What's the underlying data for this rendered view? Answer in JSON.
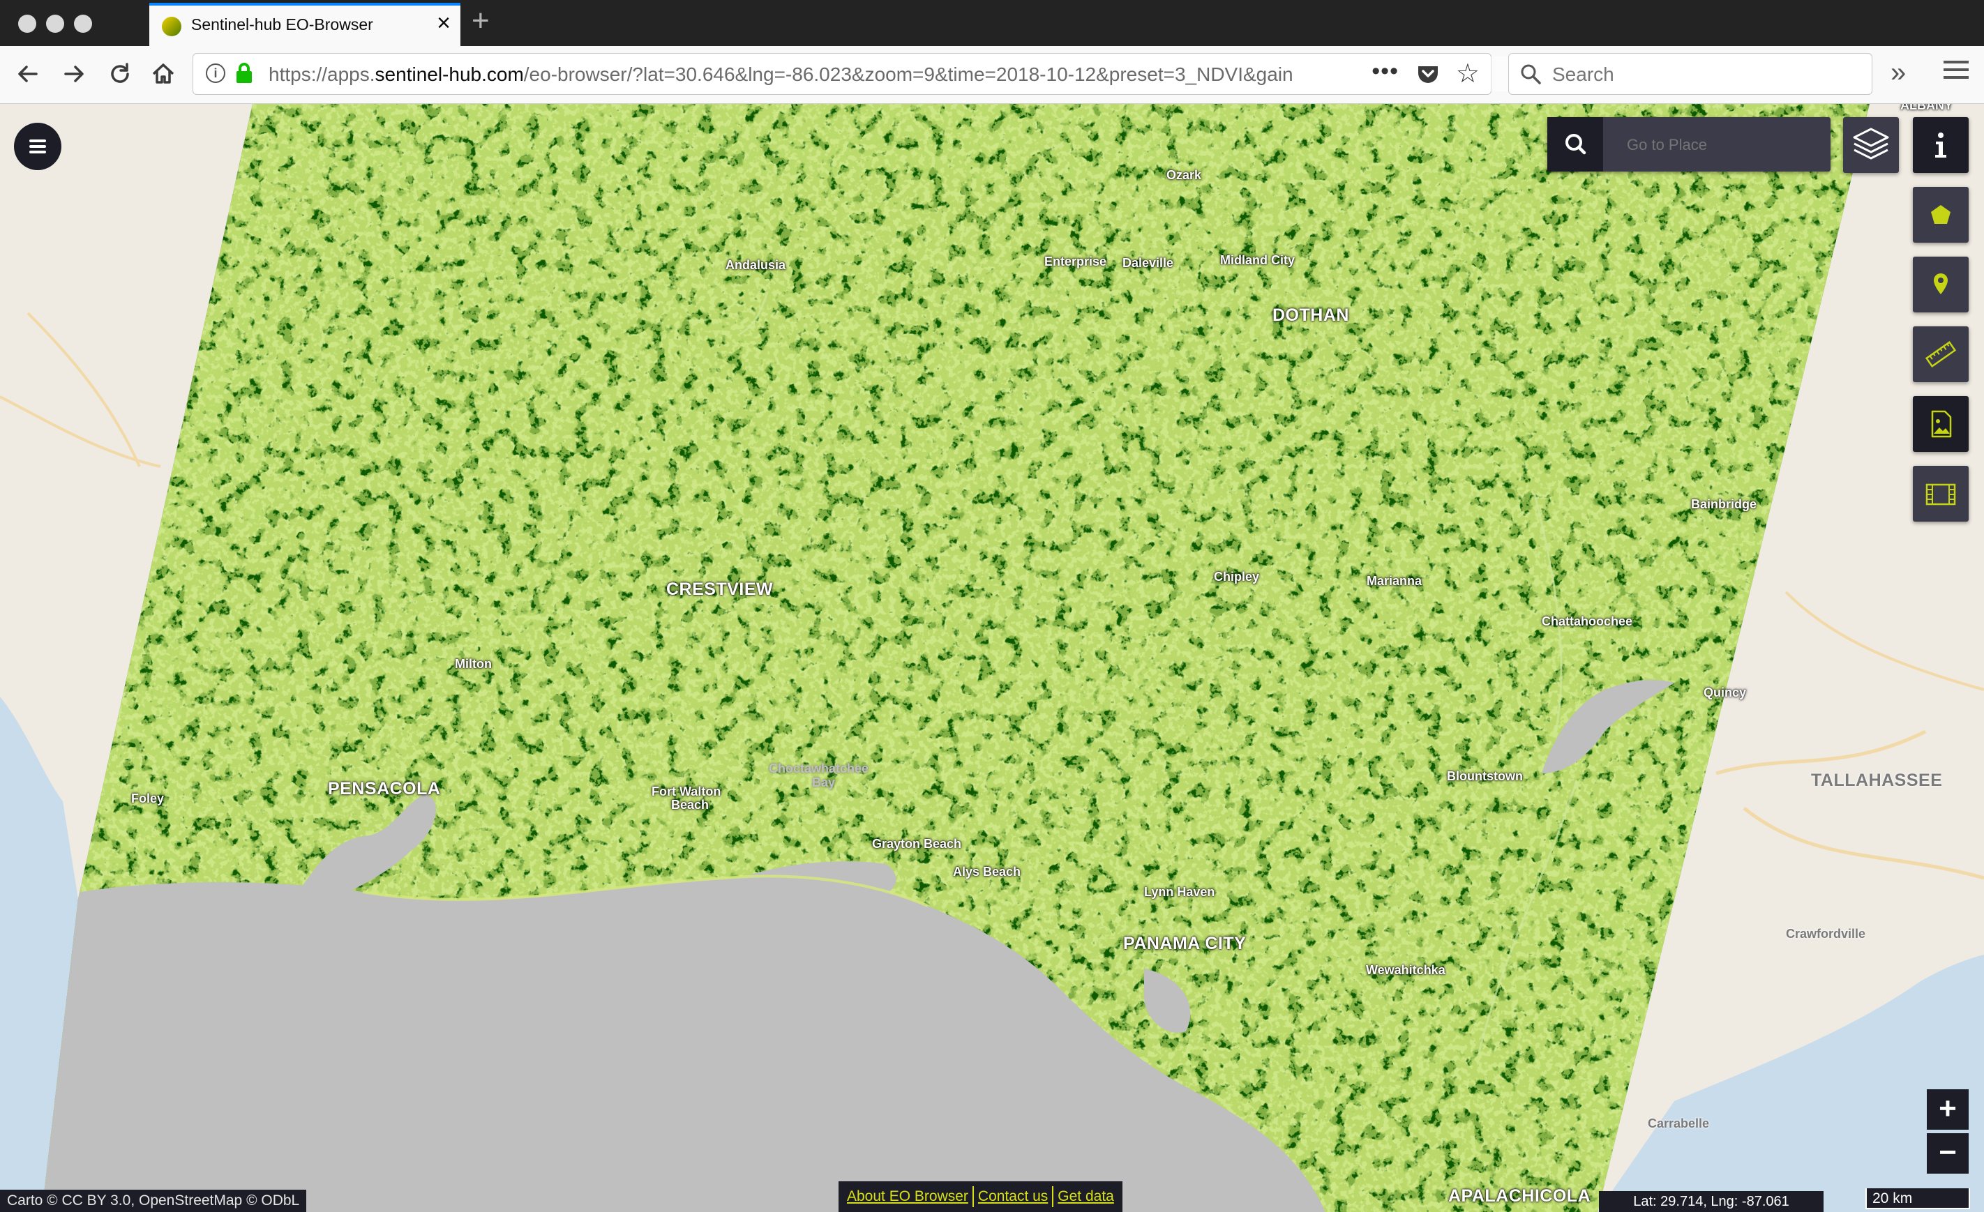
{
  "browser": {
    "tab_title": "Sentinel-hub EO-Browser",
    "url_prefix": "https://apps.",
    "url_domain": "sentinel-hub.com",
    "url_rest": "/eo-browser/?lat=30.646&lng=-86.023&zoom=9&time=2018-10-12&preset=3_NDVI&gain",
    "search_placeholder": "Search"
  },
  "map": {
    "goto_placeholder": "Go to Place",
    "places_in_scene": {
      "ozark": "Ozark",
      "andalusia": "Andalusia",
      "enterprise": "Enterprise",
      "daleville": "Daleville",
      "midland_city": "Midland City",
      "dothan": "DOTHAN",
      "crestview": "CRESTVIEW",
      "chipley": "Chipley",
      "marianna": "Marianna",
      "bainbridge": "Bainbridge",
      "chattahoochee": "Chattahoochee",
      "milton": "Milton",
      "pensacola": "PENSACOLA",
      "foley": "Foley",
      "fort_walton_1": "Fort Walton",
      "fort_walton_2": "Beach",
      "choctawhatchee_1": "Choctawhatchee",
      "choctawhatchee_2": "Bay",
      "grayton_beach": "Grayton Beach",
      "alys_beach": "Alys Beach",
      "lynn_haven": "Lynn Haven",
      "panama_city": "PANAMA CITY",
      "wewahitchka": "Wewahitchka",
      "blountstown": "Blountstown",
      "quincy": "Quincy",
      "apalachicola": "APALACHICOLA",
      "albany": "ALBANY"
    },
    "places_outside": {
      "tallahassee": "TALLAHASSEE",
      "crawfordville": "Crawfordville",
      "carrabelle": "Carrabelle"
    },
    "attribution": "Carto © CC BY 3.0, OpenStreetMap © ODbL",
    "footer_links": [
      "About EO Browser",
      "Contact us",
      "Get data"
    ],
    "coordinates": "Lat: 29.714, Lng: -87.061",
    "scale": "20 km",
    "zoom_in": "+",
    "zoom_out": "−",
    "accent_color": "#d6e014",
    "ndvi_color": "#0d5a00"
  }
}
